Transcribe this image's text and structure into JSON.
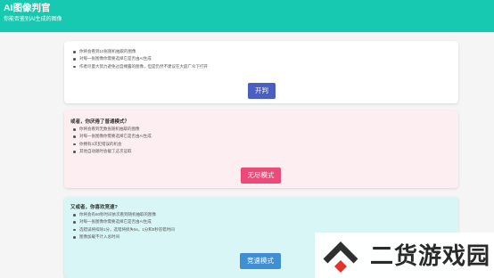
{
  "header": {
    "title": "AI图像判官",
    "subtitle": "你能否鉴别AI生成的图像"
  },
  "card_start": {
    "rules": [
      "你将会看到10张随机抽取的图像",
      "对每一张图像你需要选择它是否由AI生成",
      "作者尽量大努力避免过度裸露的图像，但是仍然不建议在大庭广众下打开"
    ],
    "button_label": "开判"
  },
  "card_endless": {
    "title": "或者，你厌倦了普通模式？",
    "rules": [
      "你将会看到无数张随机抽取的图像",
      "对每一张图像你需要选择它是否由AI生成",
      "你拥有3次犯错误的机会",
      "其他自动随时会截了这次证取"
    ],
    "button_label": "无尽模式"
  },
  "card_speed": {
    "title": "又或者，你喜欢竞速?",
    "rules": [
      "你将会有60秒时间依次看到随机抽取的图像",
      "对每一张图像你需要选择它是否由AI生成",
      "选错误将扣除1分，选错将损失5s，1分和0秒答错时间",
      "图像加载不计入总时间"
    ],
    "button_label": "竞速模式"
  },
  "watermark": {
    "text": "二货游戏园",
    "icon": "chevron-up-logo-icon"
  },
  "colors": {
    "header": "#17c9b0",
    "start_button": "#4a5fc1",
    "endless_button": "#ea4b78",
    "speed_button": "#3f8fd2",
    "endless_card": "#fdeef1",
    "speed_card": "#d9f6f6"
  }
}
